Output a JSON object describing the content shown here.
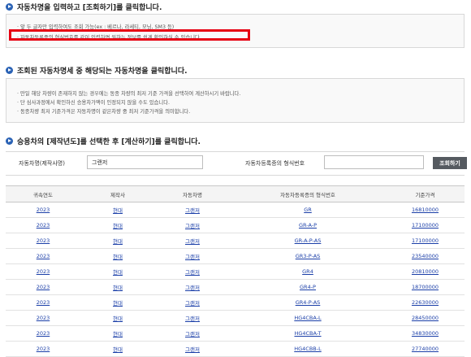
{
  "section1": {
    "title": "자동차명을 입력하고 [조회하기]를 클릭합니다.",
    "notes": [
      "· 앞 두 글자만 입력하여도 조회 가능(ex : 베르나, 라세티, 모닝, SM3 등)",
      "· 자동차등록증의 형식번호를 같이 입력하면 원하는 정보를 쉽게 확인하실 수 있습니다."
    ]
  },
  "section2": {
    "title": "조회된 자동차명세 중 해당되는 자동차명을 클릭합니다.",
    "notes": [
      "· 만일 해당 차량이 존재하지 않는 경우에는 동종 차량의 최저 기준 가격을 선택하여 계산하시기 바랍니다.",
      "· 단 심사과정에서 확인하신 승용차가액이 인정되지 않을 수도 있습니다.",
      "· 동종차량 최저 기준가격은 자동차명이 같은차량 중  최저 기준가격을 의미합니다."
    ]
  },
  "section3": {
    "title": "승용차의 [제작년도]를 선택한 후 [계산하기]를 클릭합니다."
  },
  "search": {
    "car_name_label": "자동차명(제작사명)",
    "car_name_value": "그랜저",
    "model_no_label": "자동차등록증의 형식번호",
    "model_no_value": "",
    "button_label": "조회하기"
  },
  "table": {
    "headers": [
      "귀속연도",
      "제작사",
      "자동차명",
      "자동차등록증의 형식번호",
      "기준가격"
    ],
    "rows": [
      {
        "year": "2023",
        "maker": "현대",
        "name": "그랜저",
        "model": "GR",
        "price": "16810000"
      },
      {
        "year": "2023",
        "maker": "현대",
        "name": "그랜저",
        "model": "GR-A-P",
        "price": "17100000"
      },
      {
        "year": "2023",
        "maker": "현대",
        "name": "그랜저",
        "model": "GR-A-P-AS",
        "price": "17100000"
      },
      {
        "year": "2023",
        "maker": "현대",
        "name": "그랜저",
        "model": "GR3-P-AS",
        "price": "23540000"
      },
      {
        "year": "2023",
        "maker": "현대",
        "name": "그랜저",
        "model": "GR4",
        "price": "20810000"
      },
      {
        "year": "2023",
        "maker": "현대",
        "name": "그랜저",
        "model": "GR4-P",
        "price": "18700000"
      },
      {
        "year": "2023",
        "maker": "현대",
        "name": "그랜저",
        "model": "GR4-P-AS",
        "price": "22630000"
      },
      {
        "year": "2023",
        "maker": "현대",
        "name": "그랜저",
        "model": "HG4CBA-L",
        "price": "28450000"
      },
      {
        "year": "2023",
        "maker": "현대",
        "name": "그랜저",
        "model": "HG4CBA-T",
        "price": "34830000"
      },
      {
        "year": "2023",
        "maker": "현대",
        "name": "그랜저",
        "model": "HG4CBB-L",
        "price": "27740000"
      }
    ]
  }
}
